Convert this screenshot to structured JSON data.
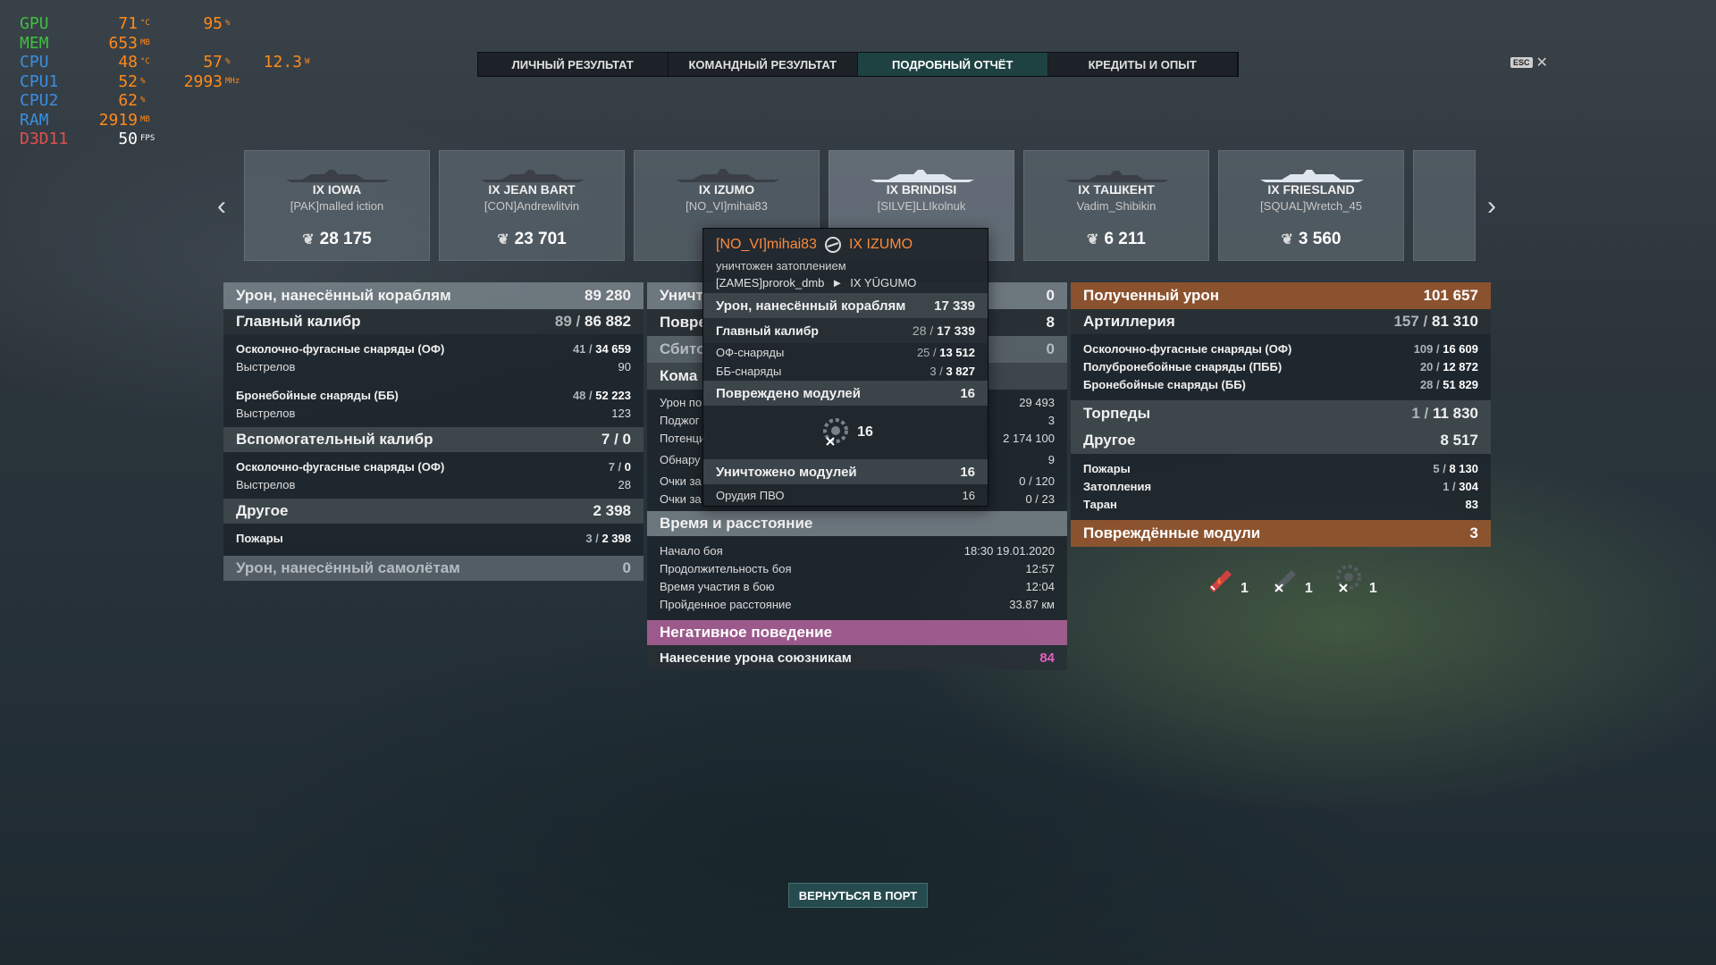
{
  "osd": [
    {
      "label": "GPU",
      "color": "green",
      "v1": "71",
      "u1": "°C",
      "v2": "95",
      "u2": "%",
      "v3": "",
      "u3": ""
    },
    {
      "label": "MEM",
      "color": "green",
      "v1": "653",
      "u1": "MB",
      "v2": "",
      "u2": "",
      "v3": "",
      "u3": ""
    },
    {
      "label": "CPU",
      "color": "blue",
      "v1": "48",
      "u1": "°C",
      "v2": "57",
      "u2": "%",
      "v3": "12.3",
      "u3": "W"
    },
    {
      "label": "CPU1",
      "color": "blue",
      "v1": "52",
      "u1": "%",
      "v2": "2993",
      "u2": "MHz",
      "v3": "",
      "u3": ""
    },
    {
      "label": "CPU2",
      "color": "blue",
      "v1": "62",
      "u1": "%",
      "v2": "",
      "u2": "",
      "v3": "",
      "u3": ""
    },
    {
      "label": "RAM",
      "color": "blue",
      "v1": "2919",
      "u1": "MB",
      "v2": "",
      "u2": "",
      "v3": "",
      "u3": ""
    },
    {
      "label": "D3D11",
      "color": "red",
      "v1": "50",
      "u1": "FPS",
      "v2": "",
      "u2": "",
      "v3": "",
      "u3": ""
    }
  ],
  "tabs": [
    {
      "label": "ЛИЧНЫЙ РЕЗУЛЬТАТ",
      "active": false
    },
    {
      "label": "КОМАНДНЫЙ РЕЗУЛЬТАТ",
      "active": false
    },
    {
      "label": "ПОДРОБНЫЙ ОТЧЁТ",
      "active": true
    },
    {
      "label": "КРЕДИТЫ И ОПЫТ",
      "active": false
    }
  ],
  "esc": {
    "key": "ESC",
    "close": "✕"
  },
  "ships": [
    {
      "name": "IX IOWA",
      "player": "[PAK]malled iction",
      "score": "28 175"
    },
    {
      "name": "IX JEAN BART",
      "player": "[CON]Andrewlitvin",
      "score": "23 701"
    },
    {
      "name": "IX IZUMO",
      "player": "[NO_VI]mihai83",
      "score": ""
    },
    {
      "name": "IX BRINDISI",
      "player": "[SILVE]LLIkolnuk",
      "score": ""
    },
    {
      "name": "IX ТАШКЕНТ",
      "player": "Vadim_Shibikin",
      "score": "6 211"
    },
    {
      "name": "IX FRIESLAND",
      "player": "[SQUAL]Wretch_45",
      "score": "3 560"
    }
  ],
  "left": {
    "header": {
      "label": "Урон, нанесённый кораблям",
      "value": "89 280"
    },
    "main": {
      "label": "Главный калибр",
      "pre": "89 / ",
      "val": "86 882"
    },
    "he": {
      "label": "Осколочно-фугасные снаряды (ОФ)",
      "pre": "41 / ",
      "val": "34 659"
    },
    "he_shots": {
      "label": "Выстрелов",
      "value": "90"
    },
    "ap": {
      "label": "Бронебойные снаряды (ББ)",
      "pre": "48 / ",
      "val": "52 223"
    },
    "ap_shots": {
      "label": "Выстрелов",
      "value": "123"
    },
    "secondary": {
      "label": "Вспомогательный калибр",
      "value": "7 / 0"
    },
    "sec_he": {
      "label": "Осколочно-фугасные снаряды (ОФ)",
      "pre": "7 / ",
      "val": "0"
    },
    "sec_shots": {
      "label": "Выстрелов",
      "value": "28"
    },
    "other": {
      "label": "Другое",
      "value": "2 398"
    },
    "fires": {
      "label": "Пожары",
      "pre": "3 / ",
      "val": "2 398"
    },
    "planes": {
      "label": "Урон, нанесённый самолётам",
      "value": "0"
    }
  },
  "middle": {
    "destroyed": {
      "label": "Уничт",
      "value": "0"
    },
    "damaged": {
      "label": "Повре",
      "value": "8"
    },
    "shotdown": {
      "label": "Сбито",
      "value": "0"
    },
    "team": {
      "label": "Кома",
      "value": ""
    },
    "rows": [
      {
        "label": "Урон по",
        "value": "29 493"
      },
      {
        "label": "Поджог",
        "value": "3"
      },
      {
        "label": "Потенци",
        "value": "2 174 100"
      },
      {
        "label": "Обнару",
        "value": "9"
      },
      {
        "label": "Очки за",
        "value": "0 / 120"
      },
      {
        "label": "Очки за",
        "value": "0 / 23"
      }
    ],
    "time_header": "Время и расстояние",
    "start": {
      "label": "Начало боя",
      "value": "18:30  19.01.2020"
    },
    "duration": {
      "label": "Продолжительность боя",
      "value": "12:57"
    },
    "participation": {
      "label": "Время участия в бою",
      "value": "12:04"
    },
    "distance": {
      "label": "Пройденное расстояние",
      "value": "33.87 км"
    },
    "negative_header": "Негативное поведение",
    "ally_damage": {
      "label": "Нанесение урона союзникам",
      "value": "84"
    }
  },
  "right": {
    "header": {
      "label": "Полученный урон",
      "value": "101 657"
    },
    "artillery": {
      "label": "Артиллерия",
      "pre": "157 / ",
      "val": "81 310"
    },
    "he": {
      "label": "Осколочно-фугасные снаряды (ОФ)",
      "pre": "109 / ",
      "val": "16 609"
    },
    "sap": {
      "label": "Полубронебойные снаряды (ПББ)",
      "pre": "20 / ",
      "val": "12 872"
    },
    "ap": {
      "label": "Бронебойные снаряды (ББ)",
      "pre": "28 / ",
      "val": "51 829"
    },
    "torpedoes": {
      "label": "Торпеды",
      "pre": "1 / ",
      "val": "11 830"
    },
    "other": {
      "label": "Другое",
      "value": "8 517"
    },
    "fires": {
      "label": "Пожары",
      "pre": "5 / ",
      "val": "8 130"
    },
    "floods": {
      "label": "Затопления",
      "pre": "1 / ",
      "val": "304"
    },
    "ram": {
      "label": "Таран",
      "value": "83"
    },
    "modules_header": {
      "label": "Повреждённые модули",
      "value": "3"
    },
    "modules": [
      {
        "icon": "gun-fire-icon",
        "count": "1"
      },
      {
        "icon": "gun-destroyed-icon",
        "count": "1"
      },
      {
        "icon": "aa-destroyed-icon",
        "count": "1"
      }
    ]
  },
  "tooltip": {
    "player": "[NO_VI]mihai83",
    "ship": "IX IZUMO",
    "status": "уничтожен затоплением",
    "killer": "[ZAMES]prorok_dmb",
    "killer_ship": "IX YŪGUMO",
    "damage": {
      "label": "Урон, нанесённый кораблям",
      "value": "17 339"
    },
    "main": {
      "label": "Главный калибр",
      "pre": "28 / ",
      "val": "17 339"
    },
    "he": {
      "label": "ОФ-снаряды",
      "pre": "25 / ",
      "val": "13 512"
    },
    "ap": {
      "label": "ББ-снаряды",
      "pre": "3 / ",
      "val": "3 827"
    },
    "damaged_modules": {
      "label": "Повреждено модулей",
      "value": "16"
    },
    "module_count": "16",
    "destroyed_modules": {
      "label": "Уничтожено модулей",
      "value": "16"
    },
    "aa": {
      "label": "Орудия ПВО",
      "value": "16"
    }
  },
  "return_button": "ВЕРНУТЬСЯ В ПОРТ",
  "colors": {
    "accent_teal": "#1e4646",
    "orange": "#ff8a3a",
    "pink_value": "#e060c0"
  }
}
